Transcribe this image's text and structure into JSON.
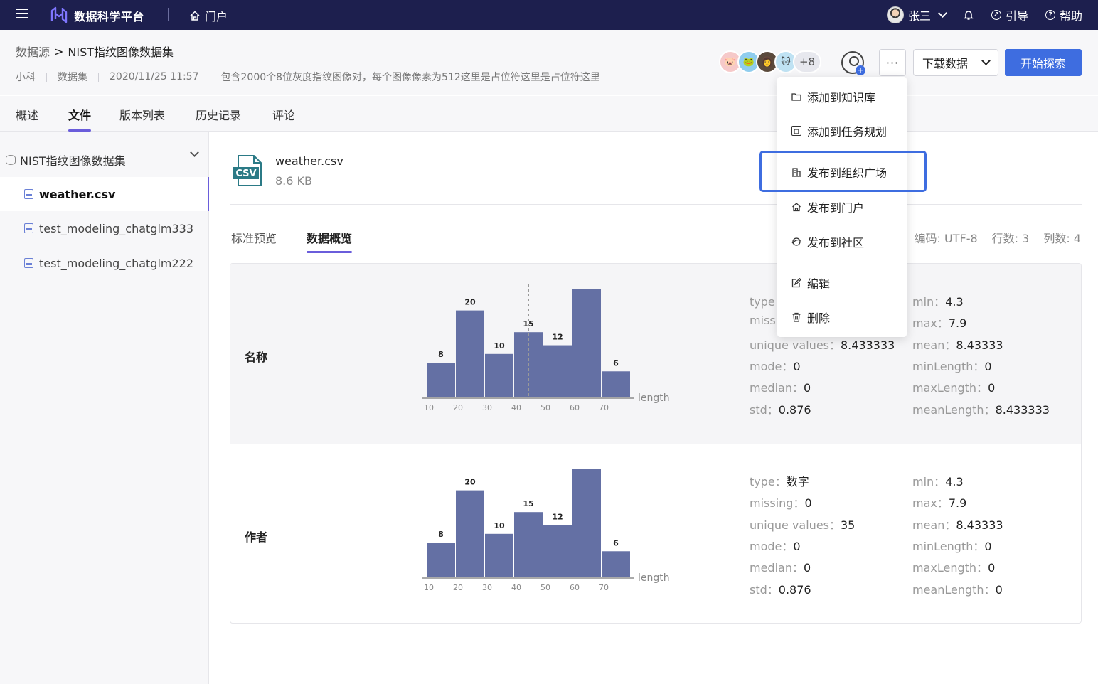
{
  "topbar": {
    "brand": "数据科学平台",
    "portal_label": "门户",
    "user_name": "张三",
    "guide_label": "引导",
    "help_label": "帮助"
  },
  "header": {
    "breadcrumb_parent": "数据源",
    "breadcrumb_sep": ">",
    "breadcrumb_current": "NIST指纹图像数据集",
    "owner": "小科",
    "type": "数据集",
    "timestamp": "2020/11/25 11:57",
    "description": "包含2000个8位灰度指纹图像对，每个图像像素为512这里是占位符这里是占位符这里",
    "member_more": "+8",
    "download_label": "下载数据",
    "explore_label": "开始探索",
    "more_label": "···"
  },
  "tabs": [
    {
      "label": "概述"
    },
    {
      "label": "文件"
    },
    {
      "label": "版本列表"
    },
    {
      "label": "历史记录"
    },
    {
      "label": "评论"
    }
  ],
  "sidebar": {
    "root_label": "NIST指纹图像数据集",
    "files": [
      {
        "name": "weather.csv"
      },
      {
        "name": "test_modeling_chatglm333"
      },
      {
        "name": "test_modeling_chatglm222"
      }
    ]
  },
  "file": {
    "icon_text": "CSV",
    "name": "weather.csv",
    "size": "8.6 KB"
  },
  "subtabs": [
    {
      "label": "标准预览"
    },
    {
      "label": "数据概览"
    }
  ],
  "file_meta": {
    "encoding": "编码: UTF-8",
    "rows": "行数: 3",
    "cols": "列数: 4"
  },
  "columns": [
    {
      "label": "名称",
      "stats_left": [
        {
          "key": "type：",
          "value": ""
        },
        {
          "key": "missi",
          "value": ""
        },
        {
          "key": "unique values：",
          "value": "8.433333"
        },
        {
          "key": "mode：",
          "value": "0"
        },
        {
          "key": "median：",
          "value": "0"
        },
        {
          "key": "std：",
          "value": "0.876"
        }
      ],
      "stats_right": [
        {
          "key": "min：",
          "value": "4.3"
        },
        {
          "key": "max：",
          "value": "7.9"
        },
        {
          "key": "mean：",
          "value": "8.43333"
        },
        {
          "key": "minLength：",
          "value": "0"
        },
        {
          "key": "maxLength：",
          "value": "0"
        },
        {
          "key": "meanLength：",
          "value": "8.433333"
        }
      ]
    },
    {
      "label": "作者",
      "stats_left": [
        {
          "key": "type：",
          "value": "数字"
        },
        {
          "key": "missing：",
          "value": "0"
        },
        {
          "key": "unique values：",
          "value": "35"
        },
        {
          "key": "mode：",
          "value": "0"
        },
        {
          "key": "median：",
          "value": "0"
        },
        {
          "key": "std：",
          "value": "0.876"
        }
      ],
      "stats_right": [
        {
          "key": "min：",
          "value": "4.3"
        },
        {
          "key": "max：",
          "value": "7.9"
        },
        {
          "key": "mean：",
          "value": "8.43333"
        },
        {
          "key": "minLength：",
          "value": "0"
        },
        {
          "key": "maxLength：",
          "value": "0"
        },
        {
          "key": "meanLength：",
          "value": "0"
        }
      ]
    }
  ],
  "chart_data": [
    {
      "type": "bar",
      "categories": [
        "10",
        "20",
        "30",
        "40",
        "50",
        "60",
        "70"
      ],
      "values": [
        8,
        20,
        10,
        15,
        12,
        25,
        6
      ],
      "xlabel": "length",
      "ylim": [
        0,
        25
      ],
      "marker_line_category": "40",
      "bar_color": "#6470a4"
    },
    {
      "type": "bar",
      "categories": [
        "10",
        "20",
        "30",
        "40",
        "50",
        "60",
        "70"
      ],
      "values": [
        8,
        20,
        10,
        15,
        12,
        25,
        6
      ],
      "xlabel": "length",
      "ylim": [
        0,
        25
      ],
      "bar_color": "#6470a4"
    }
  ],
  "dropdown": {
    "items": [
      {
        "label": "添加到知识库",
        "icon": "folder-icon"
      },
      {
        "label": "添加到任务规划",
        "icon": "task-icon"
      },
      {
        "label": "发布到组织广场",
        "icon": "building-icon"
      },
      {
        "label": "发布到门户",
        "icon": "home-icon"
      },
      {
        "label": "发布到社区",
        "icon": "community-icon"
      },
      {
        "label": "编辑",
        "icon": "edit-icon"
      },
      {
        "label": "删除",
        "icon": "trash-icon"
      }
    ]
  },
  "colors": {
    "topbar_bg": "#1d1f4e",
    "accent": "#6a5ddb",
    "primary_button": "#3e6de0",
    "highlight_border": "#3e6de0"
  }
}
